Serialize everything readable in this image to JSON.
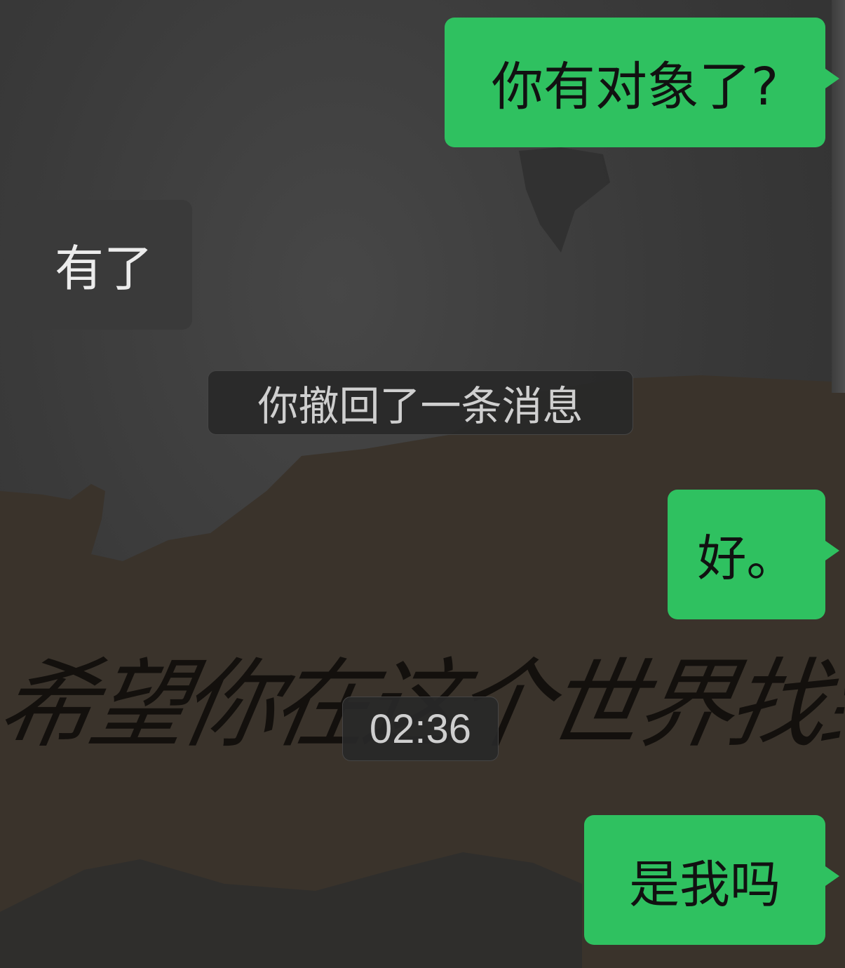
{
  "chat": {
    "messages": [
      {
        "sender": "me",
        "text": "你有对象了?"
      },
      {
        "sender": "them",
        "text": "有了"
      },
      {
        "type": "system",
        "text": "你撤回了一条消息"
      },
      {
        "sender": "me",
        "text": "好。"
      },
      {
        "type": "timestamp",
        "text": "02:36"
      },
      {
        "sender": "me",
        "text": "是我吗"
      }
    ]
  },
  "background": {
    "handwriting": "希望你在这个世界找到"
  },
  "colors": {
    "outgoing_bubble": "#2fc160",
    "incoming_bubble": "#3a3a3a",
    "system_pill": "#282828",
    "paper_brown": "#3a332b"
  }
}
